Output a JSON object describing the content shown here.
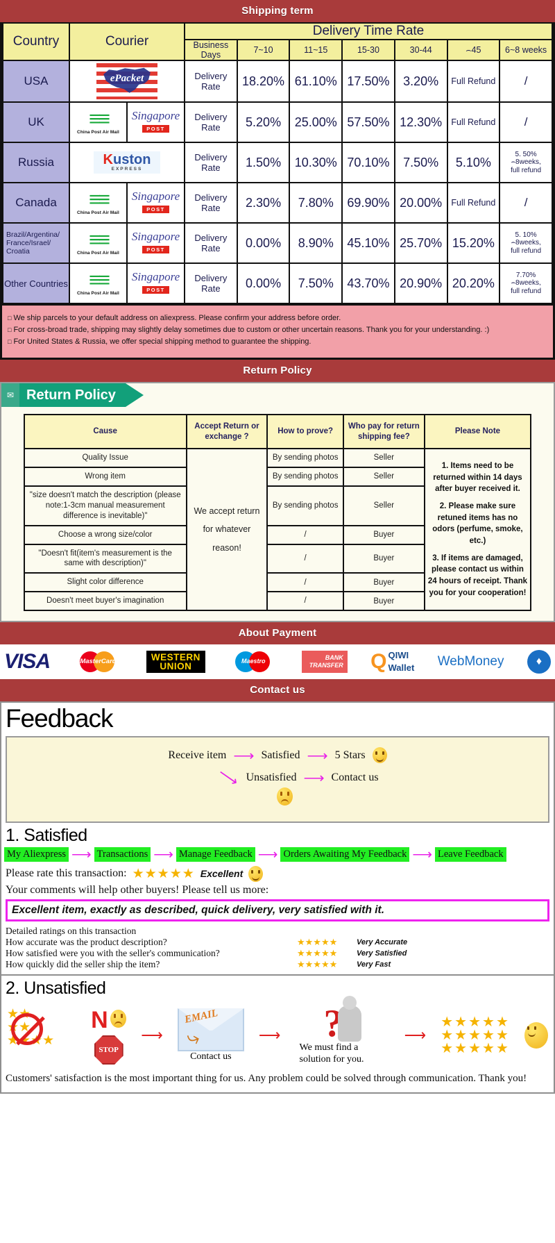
{
  "banners": {
    "shipping": "Shipping term",
    "return": "Return Policy",
    "payment": "About Payment",
    "contact": "Contact us"
  },
  "shipping": {
    "headers": {
      "country": "Country",
      "courier": "Courier",
      "delivery_time_rate": "Delivery Time Rate",
      "business_days": "Business Days",
      "cols": [
        "7~10",
        "11~15",
        "15-30",
        "30-44",
        "⌢45",
        "6~8 weeks"
      ]
    },
    "rate_label": "Delivery Rate",
    "rows": [
      {
        "country": "USA",
        "couriers": [
          "epacket"
        ],
        "values": [
          "18.20%",
          "61.10%",
          "17.50%",
          "3.20%",
          "Full Refund",
          "/"
        ]
      },
      {
        "country": "UK",
        "couriers": [
          "china-post-air-mail",
          "singapore-post"
        ],
        "values": [
          "5.20%",
          "25.00%",
          "57.50%",
          "12.30%",
          "Full Refund",
          "/"
        ]
      },
      {
        "country": "Russia",
        "couriers": [
          "kuston-express"
        ],
        "values": [
          "1.50%",
          "10.30%",
          "70.10%",
          "7.50%",
          "5.10%",
          "5. 50%\n⌢8weeks,\nfull refund"
        ]
      },
      {
        "country": "Canada",
        "couriers": [
          "china-post-air-mail",
          "singapore-post"
        ],
        "values": [
          "2.30%",
          "7.80%",
          "69.90%",
          "20.00%",
          "Full Refund",
          "/"
        ]
      },
      {
        "country": "Brazil/Argentina/ France/Israel/ Croatia",
        "couriers": [
          "china-post-air-mail",
          "singapore-post"
        ],
        "values": [
          "0.00%",
          "8.90%",
          "45.10%",
          "25.70%",
          "15.20%",
          "5. 10%\n⌢8weeks,\nfull refund"
        ]
      },
      {
        "country": "Other Countries",
        "couriers": [
          "china-post-air-mail",
          "singapore-post"
        ],
        "values": [
          "0.00%",
          "7.50%",
          "43.70%",
          "20.90%",
          "20.20%",
          "7.70%\n⌢8weeks,\nfull refund"
        ]
      }
    ],
    "notes": [
      "We ship parcels to your default address on aliexpress. Please confirm your address before order.",
      "For cross-broad trade, shipping may slightly delay sometimes due to custom or other uncertain reasons. Thank you for your understanding. :)",
      "For United States & Russia, we offer special shipping method to guarantee the shipping."
    ]
  },
  "return_policy": {
    "tag_label": "Return Policy",
    "headers": [
      "Cause",
      "Accept Return or exchange ?",
      "How to prove?",
      "Who pay for return shipping fee?",
      "Please Note"
    ],
    "accept_text": "We accept return for whatever reason!",
    "rows": [
      {
        "cause": "Quality Issue",
        "prove": "By sending photos",
        "who": "Seller"
      },
      {
        "cause": "Wrong item",
        "prove": "By sending photos",
        "who": "Seller"
      },
      {
        "cause": "\"size doesn't match the description (please note:1-3cm manual measurement difference is inevitable)\"",
        "prove": "By sending photos",
        "who": "Seller"
      },
      {
        "cause": "Choose a wrong size/color",
        "prove": "/",
        "who": "Buyer"
      },
      {
        "cause": "\"Doesn't fit(item's measurement is the same with description)\"",
        "prove": "/",
        "who": "Buyer"
      },
      {
        "cause": "Slight color difference",
        "prove": "/",
        "who": "Buyer"
      },
      {
        "cause": "Doesn't meet buyer's imagination",
        "prove": "/",
        "who": "Buyer"
      }
    ],
    "notes": [
      "1. Items need to be returned within 14 days after buyer received it.",
      "2. Please make sure retuned items has no odors (perfume, smoke, etc.)",
      "3. If items are damaged, please contact us within 24 hours of receipt. Thank you for your cooperation!"
    ]
  },
  "payment": {
    "methods": [
      {
        "name": "visa",
        "label": "VISA"
      },
      {
        "name": "mastercard",
        "label": "MasterCard"
      },
      {
        "name": "western-union",
        "label1": "WESTERN",
        "label2": "UNION"
      },
      {
        "name": "maestro",
        "label": "Maestro"
      },
      {
        "name": "bank-transfer",
        "label1": "BANK",
        "label2": "TRANSFER"
      },
      {
        "name": "qiwi-wallet",
        "label1": "QIWI",
        "label2": "Wallet"
      },
      {
        "name": "webmoney",
        "label": "WebMoney"
      }
    ]
  },
  "feedback": {
    "title": "Feedback",
    "flow": {
      "start": "Receive item",
      "satisfied": "Satisfied",
      "five_stars": "5 Stars",
      "unsatisfied": "Unsatisfied",
      "contact_us": "Contact us"
    },
    "satisfied": {
      "heading": "1. Satisfied",
      "chain": [
        "My Aliexpress",
        "Transactions",
        "Manage Feedback",
        "Orders Awaiting My Feedback",
        "Leave Feedback"
      ],
      "rate_prompt": "Please rate this transaction:",
      "stars": "★★★★★",
      "rating_label": "Excellent",
      "comment_prompt": "Your comments will help other buyers! Please tell us more:",
      "comment": "Excellent item, exactly as described, quick delivery, very satisfied with it.",
      "detail_heading": "Detailed ratings on this transaction",
      "details": [
        {
          "question": "How accurate was the product description?",
          "stars": "★★★★★",
          "label": "Very Accurate"
        },
        {
          "question": "How satisfied were you with the seller's communication?",
          "stars": "★★★★★",
          "label": "Very Satisfied"
        },
        {
          "question": "How quickly did the seller ship the item?",
          "stars": "★★★★★",
          "label": "Very Fast"
        }
      ]
    },
    "unsatisfied": {
      "heading": "2. Unsatisfied",
      "no_label": "N",
      "stop_label": "STOP",
      "email_label": "EMAIL",
      "contact_caption": "Contact us",
      "solution_caption": "We must find a solution for you.",
      "final_note": "Customers' satisfaction is the most important thing for us. Any problem could be solved through communication. Thank you!"
    }
  }
}
